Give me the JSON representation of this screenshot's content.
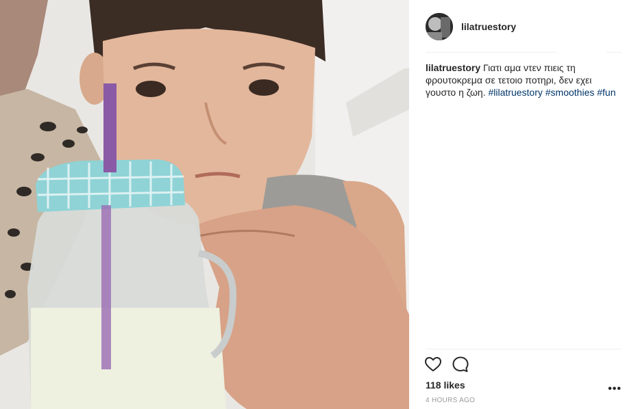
{
  "post": {
    "username": "lilatruestory",
    "caption": {
      "username": "lilatruestory",
      "text": "Γιατι αμα ντεν πιεις τη φρουτοκρεμα σε τετοιο ποτηρι, δεν εχει γουστο η ζωη.",
      "hashtags": [
        "#lilatruestory",
        "#smoothies",
        "#fun"
      ]
    },
    "likes": "118 likes",
    "timestamp": "4 HOURS AGO",
    "more_label": "•••",
    "icons": {
      "like": "heart-icon",
      "comment": "comment-icon",
      "more": "more-options-icon"
    },
    "colors": {
      "hashtag": "#003569",
      "text": "#262626",
      "timestamp": "#999999",
      "divider": "#efefef"
    }
  }
}
